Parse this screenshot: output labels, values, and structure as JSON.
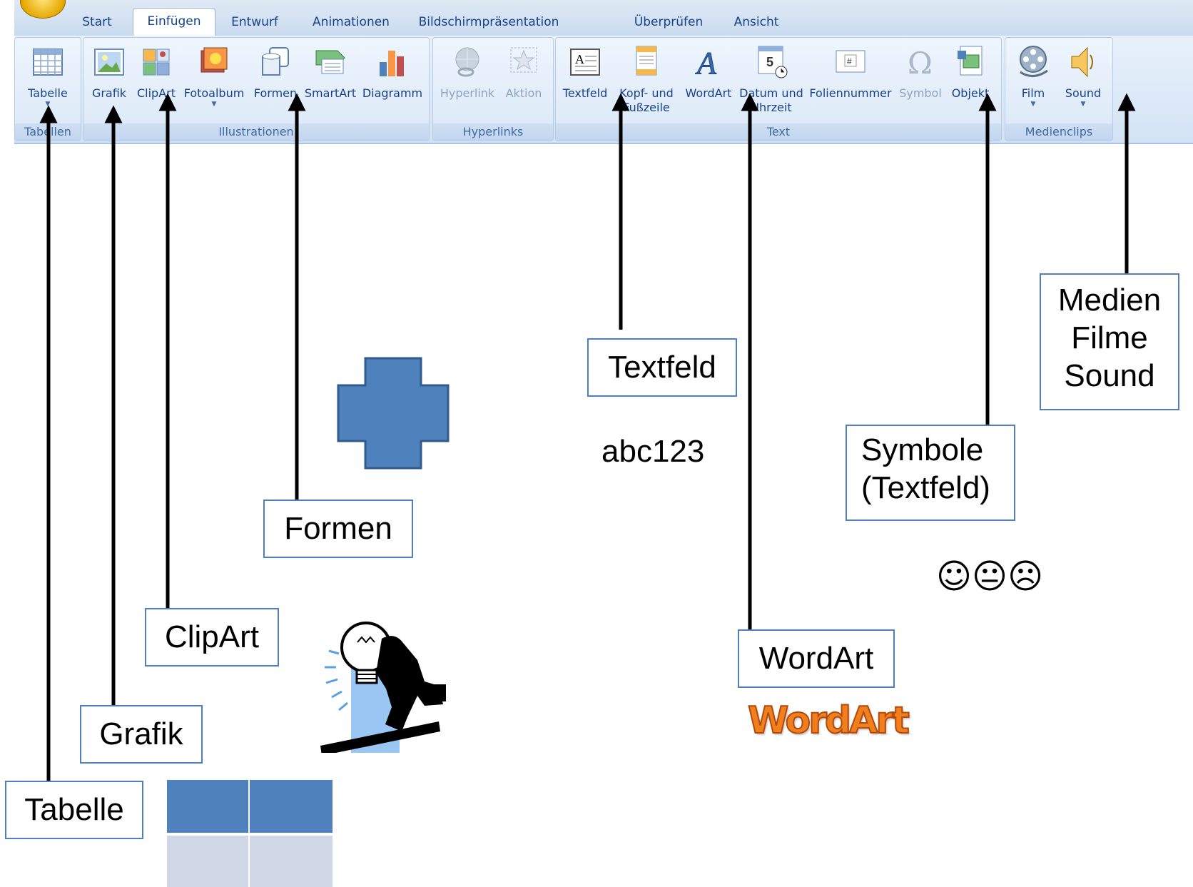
{
  "ribbon": {
    "tabs": [
      "Start",
      "Einfügen",
      "Entwurf",
      "Animationen",
      "Bildschirmpräsentation",
      "Überprüfen",
      "Ansicht"
    ],
    "active_tab": "Einfügen",
    "groups": {
      "tabellen": "Tabellen",
      "illustrationen": "Illustrationen",
      "hyperlinks": "Hyperlinks",
      "text": "Text",
      "medienclips": "Medienclips"
    },
    "buttons": {
      "tabelle": "Tabelle",
      "grafik": "Grafik",
      "clipart": "ClipArt",
      "fotoalbum": "Fotoalbum",
      "formen": "Formen",
      "smartart": "SmartArt",
      "diagramm": "Diagramm",
      "hyperlink": "Hyperlink",
      "aktion": "Aktion",
      "textfeld": "Textfeld",
      "kopf_line1": "Kopf- und",
      "kopf_line2": "Fußzeile",
      "wordart": "WordArt",
      "datum_line1": "Datum und",
      "datum_line2": "Uhrzeit",
      "foliennummer": "Foliennummer",
      "symbol": "Symbol",
      "objekt": "Objekt",
      "film": "Film",
      "sound": "Sound"
    }
  },
  "callouts": {
    "tabelle": "Tabelle",
    "grafik": "Grafik",
    "clipart": "ClipArt",
    "formen": "Formen",
    "textfeld": "Textfeld",
    "wordart": "WordArt",
    "symbole_line1": "Symbole",
    "symbole_line2": "(Textfeld)",
    "medien_line1": "Medien",
    "medien_line2": "Filme",
    "medien_line3": "Sound"
  },
  "samples": {
    "text": "abc123",
    "wordart": "WordArt",
    "smileys": "☺😐☹"
  },
  "colors": {
    "ribbon_text": "#15428b",
    "shape_fill": "#4f81bd",
    "table_header": "#4f81bd",
    "table_body": "#d0d8e8",
    "wordart": "#f07f1e"
  }
}
